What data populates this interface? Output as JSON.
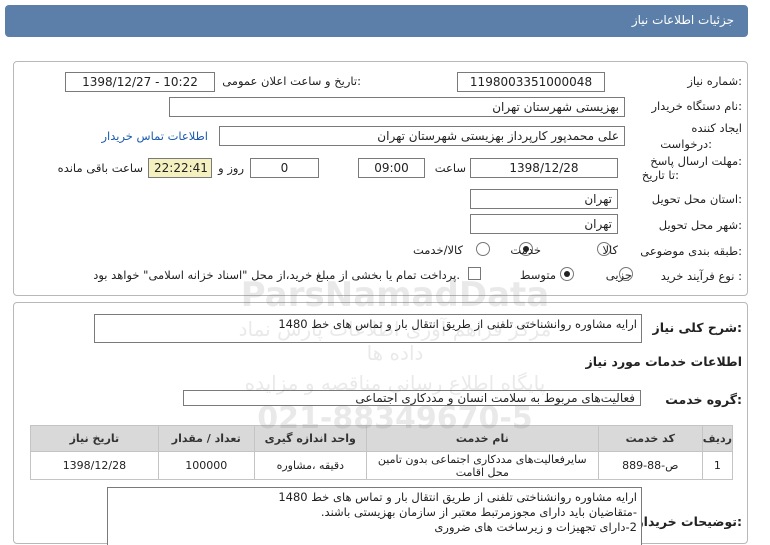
{
  "header": {
    "title": "جزئیات اطلاعات نیاز"
  },
  "form": {
    "need_number_label": "شماره نیاز:",
    "need_number": "1198003351000048",
    "announce_label": "تاریخ و ساعت اعلان عمومی:",
    "announce_value": "1398/12/27 - 10:22",
    "buyer_org_label": "نام دستگاه خریدار:",
    "buyer_org": "بهزیستی شهرستان تهران",
    "creator_label_1": "ایجاد کننده",
    "creator_label_2": "درخواست:",
    "creator": "علی  محمدپور کارپرداز  بهزیستی شهرستان تهران",
    "contact_link": "اطلاعات تماس خریدار",
    "deadline_label_1": "مهلت ارسال پاسخ:",
    "deadline_label_2": "تا تاریخ:",
    "deadline_date": "1398/12/28",
    "time_label": "ساعت",
    "deadline_time": "09:00",
    "days_value": "0",
    "days_label": "روز و",
    "remaining_time": "22:22:41",
    "remaining_label": "ساعت باقی مانده",
    "province_label": "استان محل تحویل:",
    "province": "تهران",
    "city_label": "شهر محل تحویل:",
    "city": "تهران",
    "category_label": "طبقه بندی موضوعی:",
    "category_options": [
      "کالا",
      "خدمت",
      "کالا/خدمت"
    ],
    "category_selected": "خدمت",
    "process_label": "نوع فرآیند خرید :",
    "process_options": [
      "جزیی",
      "متوسط"
    ],
    "process_selected": "متوسط",
    "payment_note": "پرداخت تمام یا بخشی از مبلغ خرید،از محل \"اسناد خزانه اسلامی\" خواهد بود."
  },
  "summary": {
    "label": "شرح کلی نیاز:",
    "text": "ارایه مشاوره روانشناختی تلفنی از طریق انتقال بار و تماس های خط 1480"
  },
  "services": {
    "section_title": "اطلاعات خدمات مورد نیاز",
    "group_label": "گروه خدمت:",
    "group_value": "فعالیت‌های مربوط به سلامت انسان و مددکاری اجتماعی",
    "columns": [
      "ردیف",
      "کد خدمت",
      "نام خدمت",
      "واحد اندازه گیری",
      "تعداد / مقدار",
      "تاریخ نیاز"
    ],
    "rows": [
      [
        "1",
        "ص-88-889",
        "سایرفعالیت‌های مددکاری اجتماعی بدون تامین محل اقامت",
        "دقیقه ،مشاوره",
        "100000",
        "1398/12/28"
      ]
    ]
  },
  "buyer_notes": {
    "label": "توضیحات خریدار:",
    "lines": [
      "ارایه مشاوره روانشناختی تلفنی از طریق انتقال بار و تماس های خط 1480",
      "-متقاضیان باید دارای مجوزمرتبط معتبر از سازمان بهزیستی باشند.",
      "2-دارای تجهیزات و زیرساخت های ضروری"
    ]
  },
  "watermark": {
    "line1": "ParsNamadData",
    "line2": "مرکز فراهم آوری اطلاعات پارس نماد داده ها",
    "line3": "پایگاه اطلاع رسانی مناقصه و مزایده",
    "line4": "021-88349670-5"
  },
  "colors": {
    "header_bg": "#5b7fa8",
    "link": "#1a5ab0",
    "remaining_bg": "#f5f0c0",
    "table_header_bg": "#d9d9d9"
  }
}
